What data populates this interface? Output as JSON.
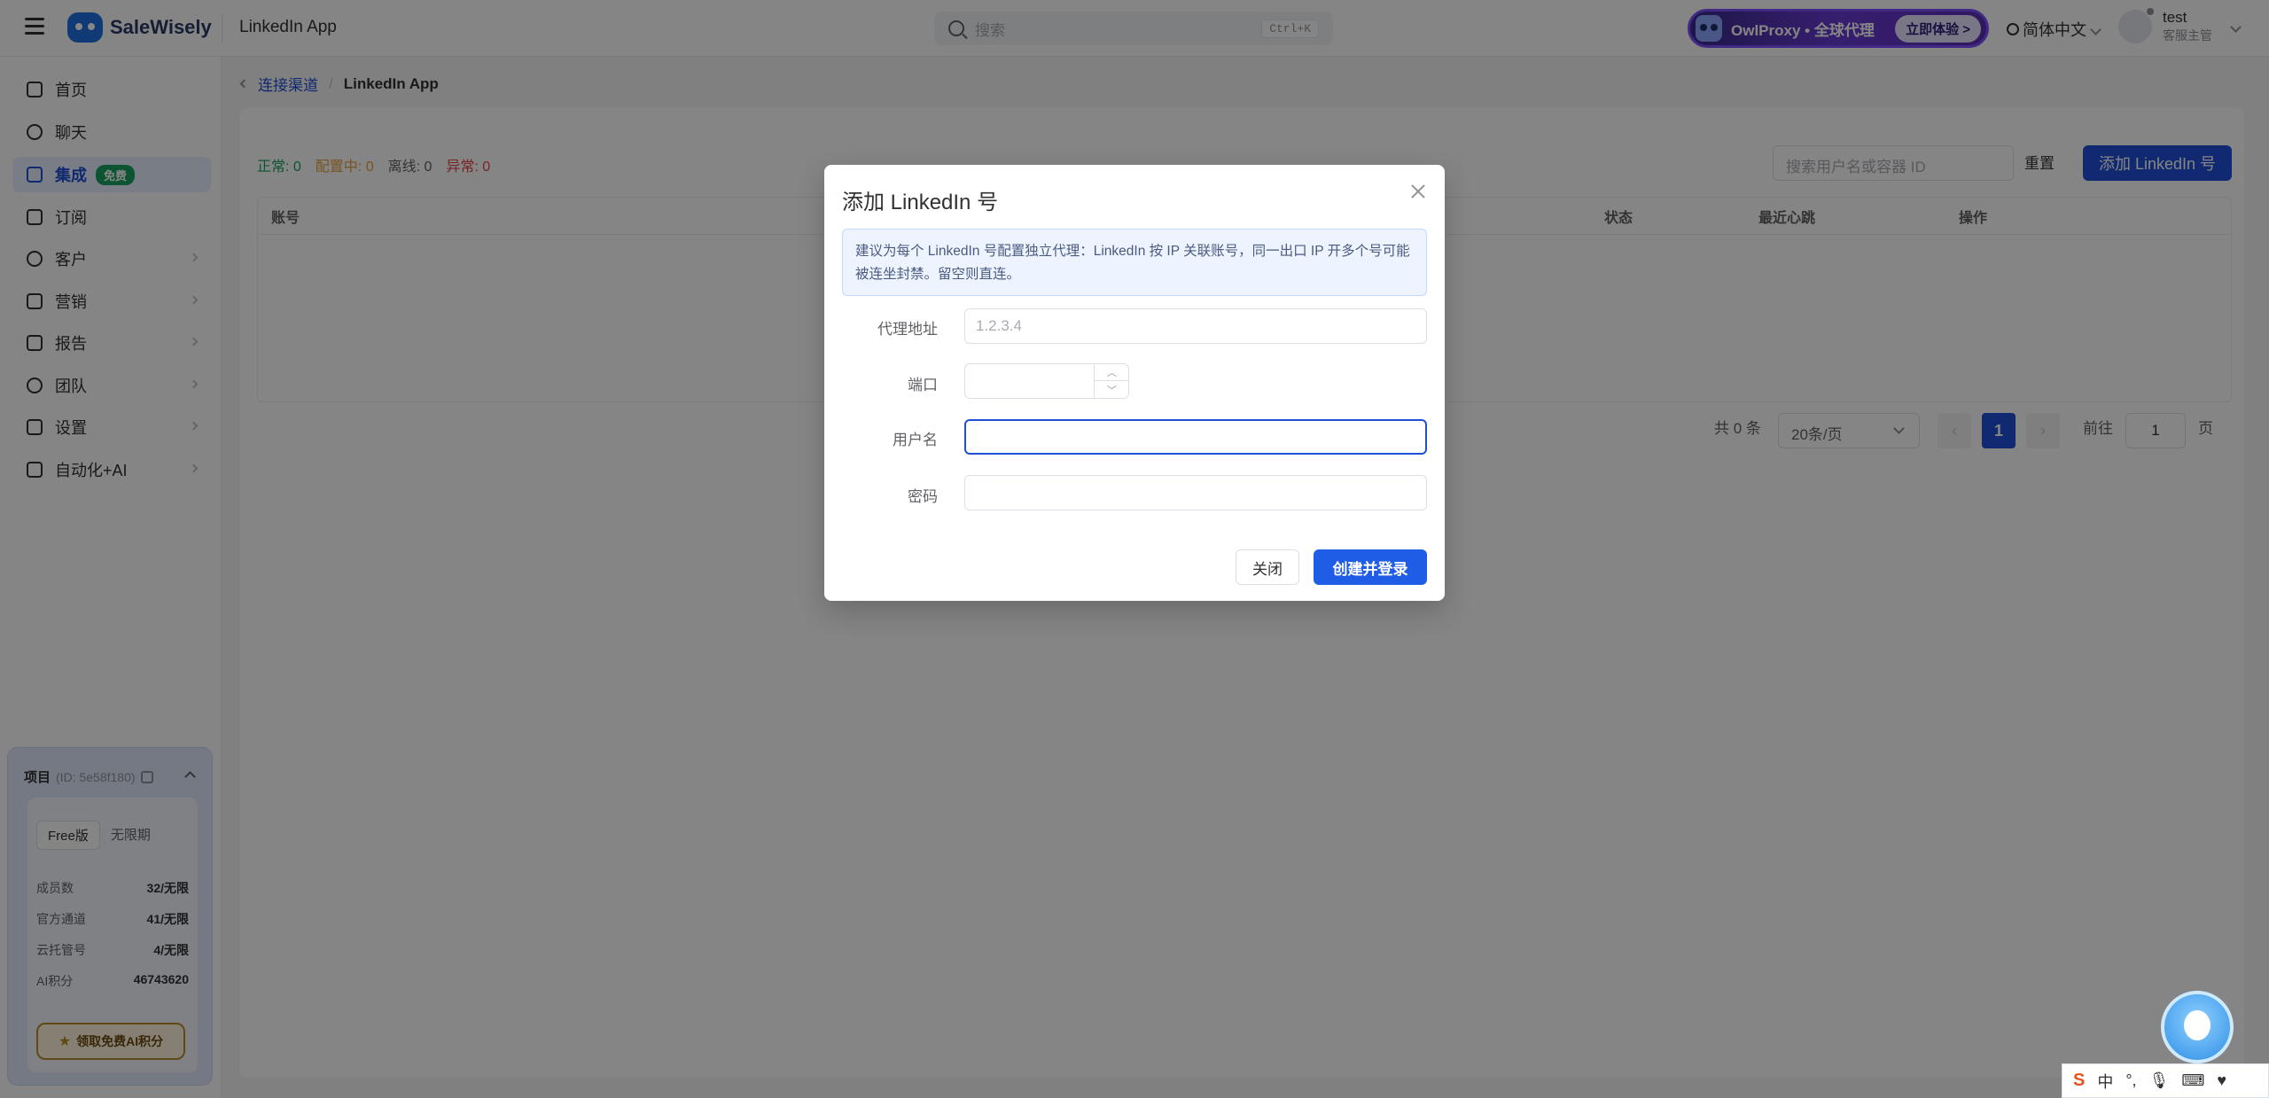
{
  "header": {
    "brand": "SaleWisely",
    "app_title": "LinkedIn App",
    "search_placeholder": "搜索",
    "search_shortcut": "Ctrl+K",
    "promo_text": "OwlProxy • 全球代理",
    "promo_button": "立即体验 >",
    "language": "简体中文",
    "user_name": "test",
    "user_role": "客服主管"
  },
  "sidebar": {
    "items": [
      {
        "label": "首页",
        "icon": "home-icon"
      },
      {
        "label": "聊天",
        "icon": "chat-icon"
      },
      {
        "label": "集成",
        "icon": "integration-icon",
        "badge": "免费",
        "active": true
      },
      {
        "label": "订阅",
        "icon": "database-icon"
      },
      {
        "label": "客户",
        "icon": "user-icon"
      },
      {
        "label": "营销",
        "icon": "send-icon"
      },
      {
        "label": "报告",
        "icon": "report-icon"
      },
      {
        "label": "团队",
        "icon": "team-icon"
      },
      {
        "label": "设置",
        "icon": "settings-icon"
      },
      {
        "label": "自动化+AI",
        "icon": "chip-icon"
      }
    ],
    "project": {
      "title": "项目",
      "id": "(ID: 5e58f180)",
      "plan_tabs": [
        "Free版",
        "无限期"
      ],
      "stats": [
        {
          "label": "成员数",
          "value": "32/无限"
        },
        {
          "label": "官方通道",
          "value": "41/无限"
        },
        {
          "label": "云托管号",
          "value": "4/无限"
        },
        {
          "label": "AI积分",
          "value": "46743620"
        }
      ],
      "claim_button": "领取免费AI积分"
    }
  },
  "breadcrumb": {
    "parent": "连接渠道",
    "separator": "/",
    "current": "LinkedIn App"
  },
  "main": {
    "status": {
      "ok": "正常: 0",
      "configuring": "配置中: 0",
      "offline": "离线: 0",
      "error": "异常: 0"
    },
    "search_placeholder": "搜索用户名或容器 ID",
    "reset_label": "重置",
    "add_button": "添加 LinkedIn 号",
    "columns": [
      "账号",
      "状态",
      "最近心跳",
      "操作"
    ],
    "pagination": {
      "total": "共 0 条",
      "page_size": "20条/页",
      "current_page": "1",
      "goto_label": "前往",
      "goto_value": "1",
      "page_suffix": "页"
    }
  },
  "modal": {
    "title": "添加 LinkedIn 号",
    "notice": "建议为每个 LinkedIn 号配置独立代理：LinkedIn 按 IP 关联账号，同一出口 IP 开多个号可能被连坐封禁。留空则直连。",
    "fields": {
      "proxy_label": "代理地址",
      "proxy_placeholder": "1.2.3.4",
      "port_label": "端口",
      "username_label": "用户名",
      "password_label": "密码"
    },
    "close_button": "关闭",
    "submit_button": "创建并登录"
  },
  "ime": {
    "mode": "中",
    "punct": "°,"
  }
}
